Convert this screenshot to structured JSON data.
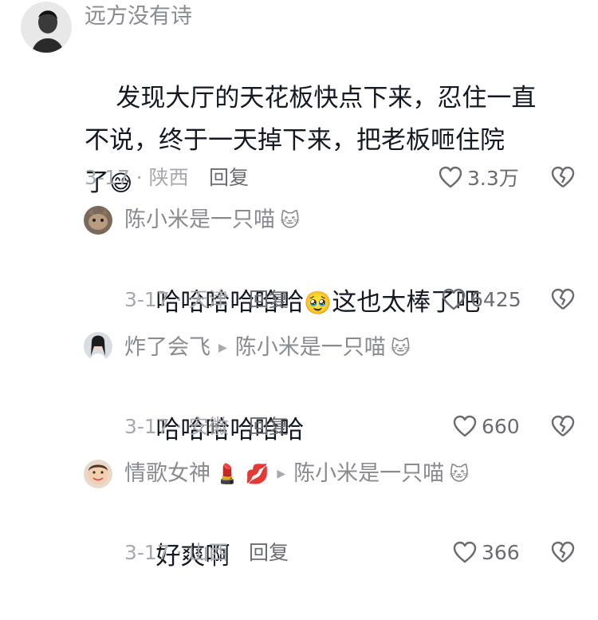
{
  "colors": {
    "text_primary": "#161823",
    "text_secondary": "#8a8b91",
    "text_meta": "#a8a9ae",
    "icon": "#6b6c72"
  },
  "comments": [
    {
      "username": "远方没有诗",
      "username_emoji": "",
      "reply_to": "",
      "reply_to_emoji": "",
      "content": "发现大厅的天花板快点下来，忍住一直\n不说，终于一天掉下来，把老板咂住院\n了",
      "content_emoji": "😅",
      "date_location": "3-17 · 陕西",
      "reply_label": "回复",
      "likes": "3.3万",
      "avatar_icon": "avatar-dark-silhouette"
    },
    {
      "username": "陈小米是一只喵",
      "username_emoji": "🐱",
      "reply_to": "",
      "reply_to_emoji": "",
      "content_before": "哈哈哈哈哈哈",
      "content_emoji": "🥹",
      "content_after": "这也太棒了吧",
      "date_location": "3-17 · 天津",
      "reply_label": "回复",
      "likes": "6425",
      "avatar_icon": "avatar-cat-photo"
    },
    {
      "username": "炸了会飞",
      "username_emoji": "",
      "reply_to": "陈小米是一只喵",
      "reply_to_emoji": "🐱",
      "content": "哈哈哈哈哈哈",
      "date_location": "3-17 · 安徽",
      "reply_label": "回复",
      "likes": "660",
      "avatar_icon": "avatar-person-photo"
    },
    {
      "username": "情歌女神",
      "username_emoji": "💄 💋",
      "reply_to": "陈小米是一只喵",
      "reply_to_emoji": "🐱",
      "content": "好爽啊",
      "date_location": "3-17 · 山西",
      "reply_label": "回复",
      "likes": "366",
      "avatar_icon": "avatar-face-photo"
    }
  ]
}
